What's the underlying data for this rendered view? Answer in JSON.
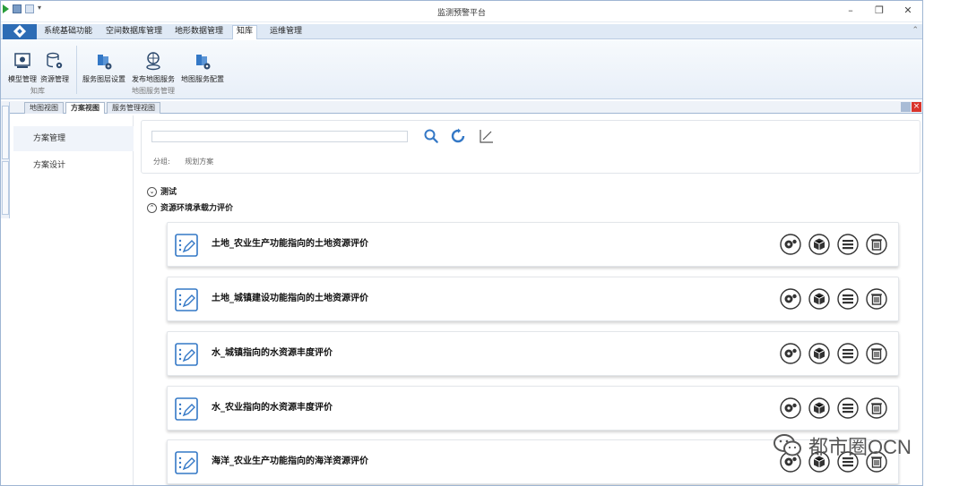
{
  "window": {
    "title": "监测预警平台",
    "controls": [
      "–",
      "❐",
      "✕"
    ]
  },
  "ribbon_tabs": [
    {
      "label": "系统基础功能",
      "active": false
    },
    {
      "label": "空间数据库管理",
      "active": false
    },
    {
      "label": "地形数据管理",
      "active": false
    },
    {
      "label": "知库",
      "active": true
    },
    {
      "label": "运维管理",
      "active": false
    }
  ],
  "ribbon": {
    "buttons": [
      {
        "label": "模型管理",
        "icon": "model-icon"
      },
      {
        "label": "资源管理",
        "icon": "database-icon"
      },
      {
        "label": "服务图层设置",
        "icon": "layer-settings-icon"
      },
      {
        "label": "发布地图服务",
        "icon": "publish-map-icon"
      },
      {
        "label": "地图服务配置",
        "icon": "map-service-config-icon"
      }
    ],
    "groups": [
      "知库",
      "地图服务管理"
    ]
  },
  "doc_tabs": [
    {
      "label": "地图视图",
      "active": false
    },
    {
      "label": "方案视图",
      "active": true
    },
    {
      "label": "服务管理视图",
      "active": false
    }
  ],
  "left_nav": [
    {
      "label": "方案管理",
      "active": true
    },
    {
      "label": "方案设计",
      "active": false
    }
  ],
  "search": {
    "value": ""
  },
  "group_filter": {
    "label": "分组:",
    "value": "规划方案"
  },
  "tree": [
    {
      "label": "测试",
      "expanded": false
    },
    {
      "label": "资源环境承载力评价",
      "expanded": true
    }
  ],
  "cards": [
    {
      "title": "土地_农业生产功能指向的土地资源评价"
    },
    {
      "title": "土地_城镇建设功能指向的土地资源评价"
    },
    {
      "title": "水_城镇指向的水资源丰度评价"
    },
    {
      "title": "水_农业指向的水资源丰度评价"
    },
    {
      "title": "海洋_农业生产功能指向的海洋资源评价"
    }
  ],
  "card_actions": [
    "settings-gear-icon",
    "box-icon",
    "list-icon",
    "trash-icon"
  ],
  "brand": {
    "text": "都市圈OCN"
  },
  "colors": {
    "accent": "#2d6cb5",
    "icon_blue": "#3478c6",
    "ribbon_bg": "#e8eff8"
  }
}
